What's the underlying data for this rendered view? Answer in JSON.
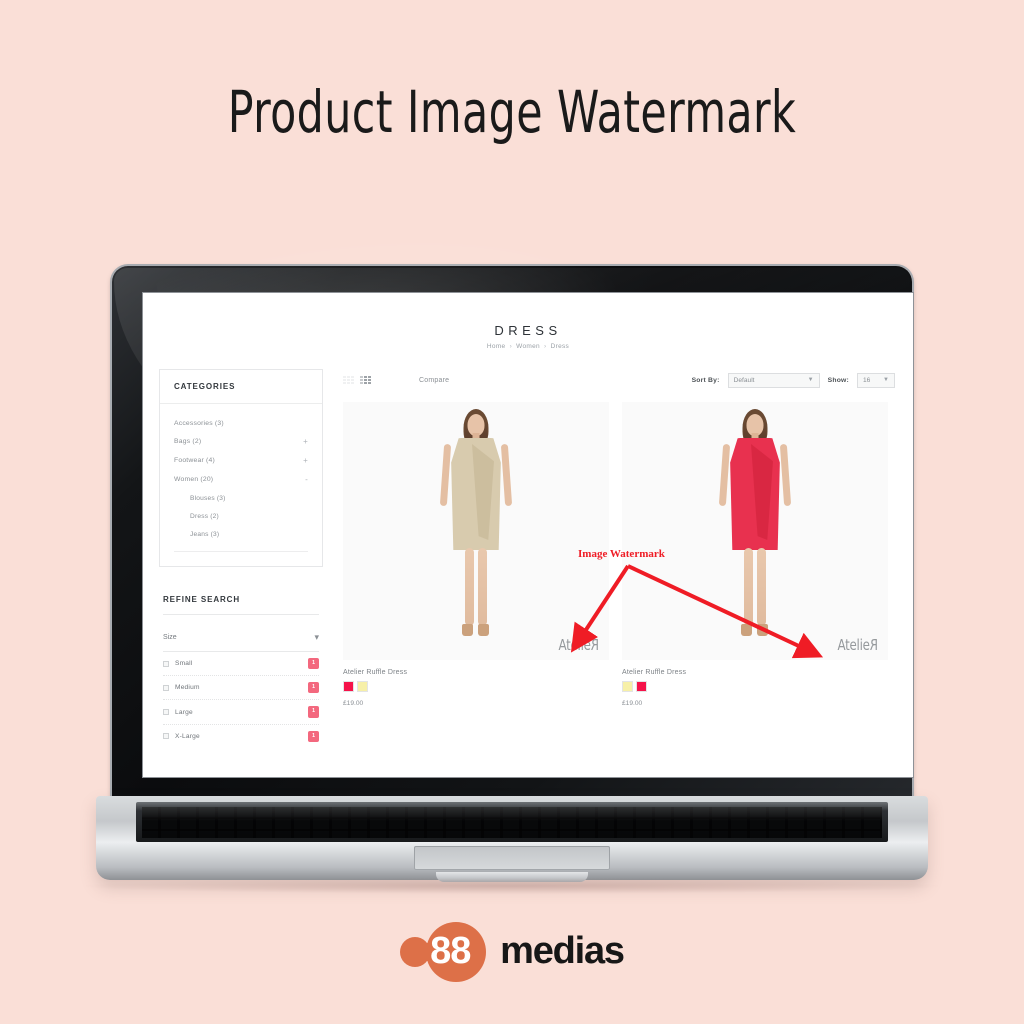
{
  "page": {
    "title": "Product Image Watermark",
    "background_color": "#fadfd7"
  },
  "site": {
    "header": {
      "title": "DRESS",
      "breadcrumb": {
        "items": [
          "Home",
          "Women",
          "Dress"
        ],
        "separator": "›"
      }
    },
    "sidebar": {
      "categories": {
        "panel_title": "CATEGORIES",
        "items": [
          {
            "label": "Accessories (3)",
            "toggle": "",
            "sub": false
          },
          {
            "label": "Bags (2)",
            "toggle": "+",
            "sub": false
          },
          {
            "label": "Footwear (4)",
            "toggle": "+",
            "sub": false
          },
          {
            "label": "Women (20)",
            "toggle": "-",
            "sub": false
          },
          {
            "label": "Blouses (3)",
            "toggle": "",
            "sub": true
          },
          {
            "label": "Dress (2)",
            "toggle": "",
            "sub": true
          },
          {
            "label": "Jeans (3)",
            "toggle": "",
            "sub": true
          }
        ]
      },
      "refine": {
        "title": "REFINE SEARCH",
        "group_label": "Size",
        "options": [
          {
            "label": "Small",
            "count": "1",
            "checked": false
          },
          {
            "label": "Medium",
            "count": "1",
            "checked": false
          },
          {
            "label": "Large",
            "count": "1",
            "checked": false
          },
          {
            "label": "X-Large",
            "count": "1",
            "checked": false
          }
        ],
        "badge_color": "#f3687e"
      }
    },
    "toolbar": {
      "compare_label": "Compare",
      "view_grid": "grid-view",
      "view_list": "list-view",
      "active_view": "list-view",
      "sort_label": "Sort By:",
      "sort_value": "Default",
      "show_label": "Show:",
      "show_value": "16"
    },
    "products": [
      {
        "name": "Atelier Ruffle Dress",
        "price": "£19.00",
        "dress_color": "#d8cbae",
        "ruffle_color": "#c9bb9b",
        "swatches": [
          "#f5134a",
          "#f7f0a8"
        ],
        "watermark": "AtelieR"
      },
      {
        "name": "Atelier Ruffle Dress",
        "price": "£19.00",
        "dress_color": "#e8314f",
        "ruffle_color": "#d5263f",
        "swatches": [
          "#f7f0a8",
          "#f5134a"
        ],
        "watermark": "AtelieR"
      }
    ]
  },
  "annotation": {
    "label": "Image Watermark",
    "color": "#ef1c25"
  },
  "footer": {
    "logo_number": "88",
    "logo_word": "medias",
    "logo_color": "#dd7048"
  }
}
